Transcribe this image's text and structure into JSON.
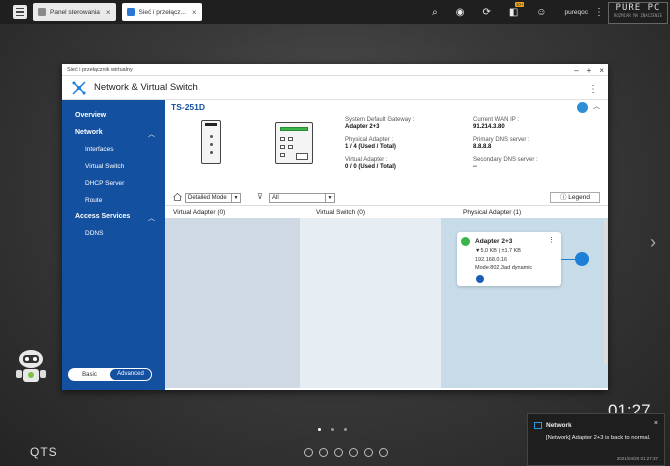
{
  "taskbar": {
    "tabs": [
      {
        "label": "Panel sterowania"
      },
      {
        "label": "Sieć i przełącz..."
      }
    ],
    "notif_badge": "10+",
    "username": "pureqoc"
  },
  "window": {
    "titlebar": "Sieć i przełącznik wirtualny",
    "app_title": "Network & Virtual Switch"
  },
  "sidebar": {
    "overview": "Overview",
    "network": "Network",
    "interfaces": "Interfaces",
    "virtual_switch": "Virtual Switch",
    "dhcp_server": "DHCP Server",
    "route": "Route",
    "access_services": "Access Services",
    "ddns": "DDNS",
    "mode_basic": "Basic",
    "mode_advanced": "Advanced"
  },
  "device": {
    "name": "TS-251D",
    "gateway_label": "System Default Gateway :",
    "gateway_value": "Adapter 2+3",
    "physical_label": "Physical Adapter :",
    "physical_value": "1 / 4 (Used / Total)",
    "virtual_label": "Virtual Adapter :",
    "virtual_value": "0 / 0 (Used / Total)",
    "wan_label": "Current WAN IP :",
    "wan_value": "91.214.3.80",
    "dns1_label": "Primary DNS server :",
    "dns1_value": "8.8.8.8",
    "dns2_label": "Secondary DNS server :",
    "dns2_value": "--"
  },
  "filters": {
    "mode_value": "Detailed Mode",
    "filter_value": "All",
    "legend_label": "Legend"
  },
  "columns": {
    "virtual_adapter": "Virtual Adapter (0)",
    "virtual_switch": "Virtual Switch (0)",
    "physical_adapter": "Physical Adapter (1)"
  },
  "adapter_card": {
    "name": "Adapter 2+3",
    "traffic": "▼5.0 KB | ±1.7 KB",
    "ip": "192.168.0.16",
    "mode": "Mode:802.3ad dynamic"
  },
  "desktop": {
    "clock": "01:27",
    "os_label": "QTS"
  },
  "notification": {
    "title": "Network",
    "message": "[Network] Adapter 2+3 is back to normal.",
    "time": "2021/04/20 01:27:37"
  },
  "colors": {
    "sidebar": "#1350a0",
    "accent": "#1e7fd6",
    "ok_green": "#3bb54a",
    "pane_left": "#ced9e3",
    "pane_mid": "#e6edf3",
    "pane_right": "#c7dce8"
  }
}
